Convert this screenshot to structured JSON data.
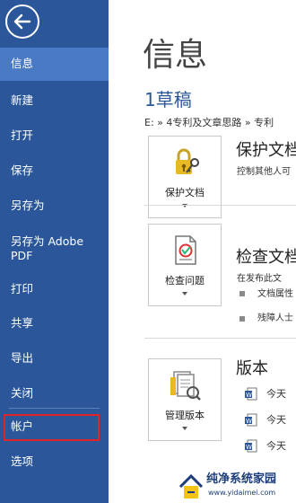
{
  "sidebar": {
    "items": [
      {
        "label": "信息",
        "active": true
      },
      {
        "label": "新建"
      },
      {
        "label": "打开"
      },
      {
        "label": "保存"
      },
      {
        "label": "另存为"
      },
      {
        "label": "另存为 Adobe PDF"
      },
      {
        "label": "打印"
      },
      {
        "label": "共享"
      },
      {
        "label": "导出"
      },
      {
        "label": "关闭"
      },
      {
        "label": "帐户"
      },
      {
        "label": "选项"
      }
    ],
    "highlight_color": "#e02424",
    "background_color": "#2b579a"
  },
  "main": {
    "title": "信息",
    "doc_name": "1草稿",
    "doc_path": "E: » 4专利及文章思路 » 专利",
    "sections": [
      {
        "tile_label": "保护文档",
        "heading": "保护文档",
        "desc": "控制其他人可"
      },
      {
        "tile_label": "检查问题",
        "heading": "检查文档",
        "desc": "在发布此文",
        "bullets": [
          "文档属性",
          "残障人士"
        ]
      },
      {
        "tile_label": "管理版本",
        "heading": "版本",
        "versions": [
          "今天",
          "今天",
          "今天"
        ]
      }
    ]
  },
  "watermark": {
    "title": "纯净系统家园",
    "url": "www.yidaimei.com"
  }
}
